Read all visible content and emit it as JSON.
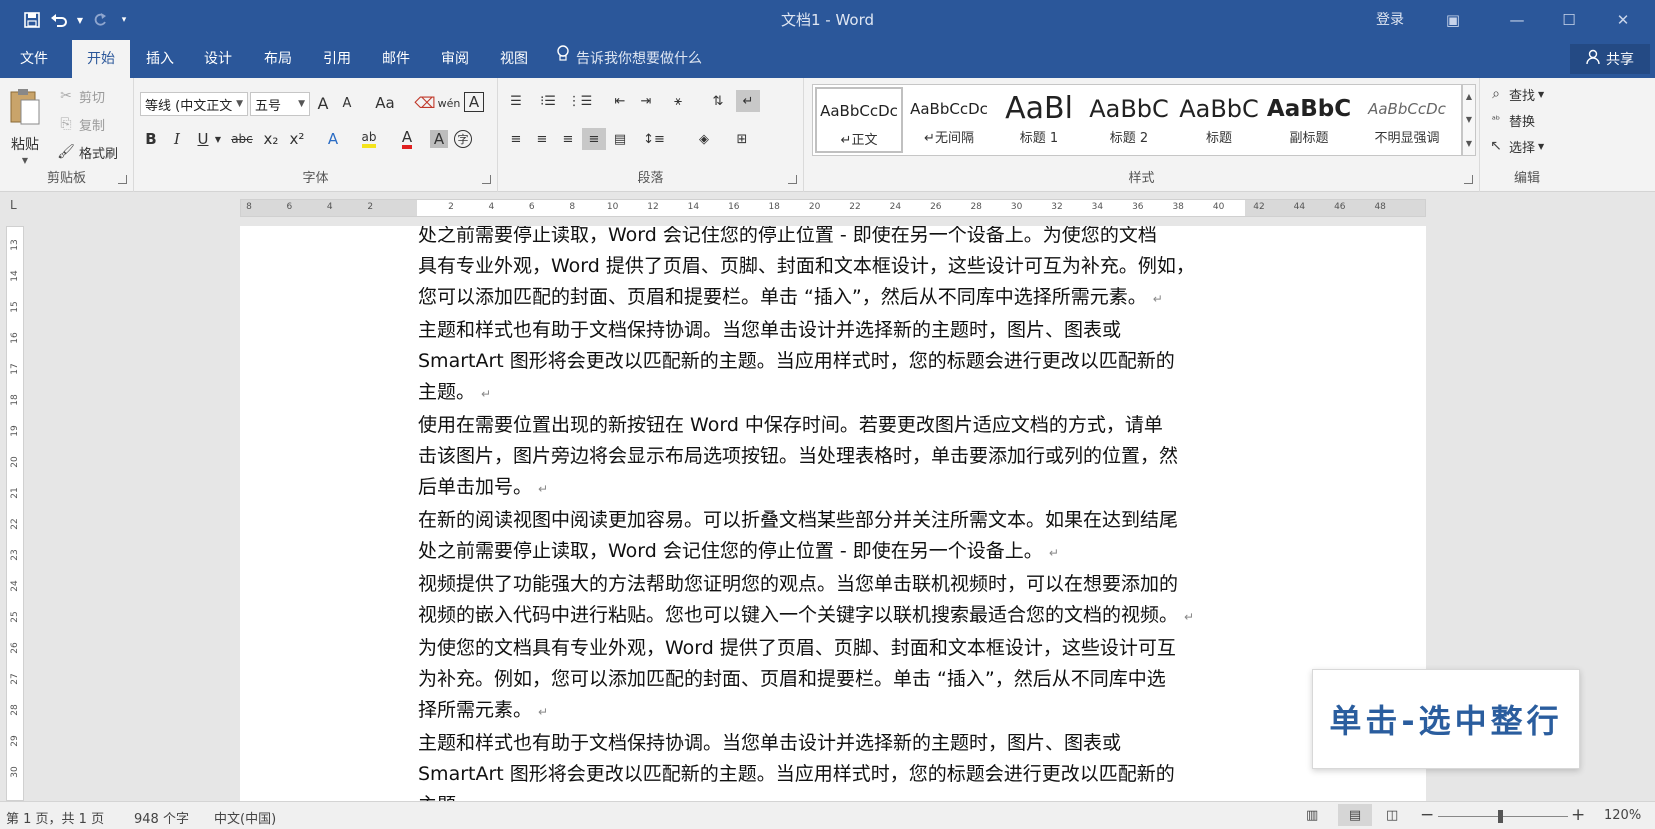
{
  "titlebar": {
    "title": "文档1 - Word",
    "login": "登录",
    "quick_access": {
      "save": "save",
      "undo": "undo",
      "redo": "redo",
      "customize": "customize"
    },
    "window_controls": {
      "ribbon_options": "▣",
      "minimize": "—",
      "maximize": "☐",
      "close": "✕"
    }
  },
  "tabs": [
    "文件",
    "开始",
    "插入",
    "设计",
    "布局",
    "引用",
    "邮件",
    "审阅",
    "视图"
  ],
  "active_tab": "开始",
  "tell_me": "告诉我你想要做什么",
  "share": "共享",
  "clipboard": {
    "label": "剪贴板",
    "paste": "粘贴",
    "cut": "剪切",
    "copy": "复制",
    "format_painter": "格式刷"
  },
  "font": {
    "label": "字体",
    "font_name": "等线 (中文正文",
    "font_size": "五号",
    "grow": "A",
    "shrink": "A",
    "case": "Aa",
    "bold": "B",
    "italic": "I",
    "underline": "U",
    "strike": "abc",
    "subscript": "x₂",
    "superscript": "x²",
    "pinyin": "wén",
    "char_border": "A",
    "text_effect": "A",
    "highlight": "ab",
    "font_color": "A",
    "char_shading": "A",
    "enclose": "字",
    "colors": {
      "highlight": "#f4e31c",
      "font_color": "#e02020"
    }
  },
  "paragraph": {
    "label": "段落"
  },
  "styles": {
    "label": "样式",
    "items": [
      {
        "sample": "AaBbCcDc",
        "name": "↵正文"
      },
      {
        "sample": "AaBbCcDc",
        "name": "↵无间隔"
      },
      {
        "sample": "AaBl",
        "name": "标题 1"
      },
      {
        "sample": "AaBbC",
        "name": "标题 2"
      },
      {
        "sample": "AaBbC",
        "name": "标题"
      },
      {
        "sample": "AaBbC",
        "name": "副标题"
      },
      {
        "sample": "AaBbCcDc",
        "name": "不明显强调"
      }
    ]
  },
  "editing": {
    "label": "编辑",
    "find": "查找",
    "replace": "替换",
    "select": "选择"
  },
  "ruler": {
    "h_ticks": [
      "8",
      "6",
      "4",
      "2",
      "",
      "2",
      "4",
      "6",
      "8",
      "10",
      "12",
      "14",
      "16",
      "18",
      "20",
      "22",
      "24",
      "26",
      "28",
      "30",
      "32",
      "34",
      "36",
      "38",
      "40",
      "42",
      "44",
      "46",
      "48"
    ],
    "v_ticks": [
      "13",
      "14",
      "15",
      "16",
      "17",
      "18",
      "19",
      "20",
      "21",
      "22",
      "23",
      "24",
      "25",
      "26",
      "27",
      "28",
      "29",
      "30"
    ],
    "corner": "L"
  },
  "document": {
    "paragraphs": [
      {
        "lines": [
          "处之前需要停止读取，Word 会记住您的停止位置 - 即使在另一个设备上。为使您的文档"
        ]
      },
      {
        "lines": [
          "具有专业外观，Word 提供了页眉、页脚、封面和文本框设计，这些设计可互为补充。例如，",
          "您可以添加匹配的封面、页眉和提要栏。单击 “插入”，然后从不同库中选择所需元素。"
        ],
        "mark": "↵"
      },
      {
        "lines": [
          "主题和样式也有助于文档保持协调。当您单击设计并选择新的主题时，图片、图表或",
          "SmartArt 图形将会更改以匹配新的主题。当应用样式时，您的标题会进行更改以匹配新的",
          "主题。"
        ],
        "mark": "↵"
      },
      {
        "lines": [
          "使用在需要位置出现的新按钮在 Word 中保存时间。若要更改图片适应文档的方式，请单",
          "击该图片，图片旁边将会显示布局选项按钮。当处理表格时，单击要添加行或列的位置，然",
          "后单击加号。"
        ],
        "mark": "↵"
      },
      {
        "lines": [
          "在新的阅读视图中阅读更加容易。可以折叠文档某些部分并关注所需文本。如果在达到结尾",
          "处之前需要停止读取，Word 会记住您的停止位置 - 即使在另一个设备上。"
        ],
        "mark": "↵"
      },
      {
        "lines": [
          "视频提供了功能强大的方法帮助您证明您的观点。当您单击联机视频时，可以在想要添加的",
          "视频的嵌入代码中进行粘贴。您也可以键入一个关键字以联机搜索最适合您的文档的视频。"
        ],
        "mark": "↵"
      },
      {
        "lines": [
          "为使您的文档具有专业外观，Word 提供了页眉、页脚、封面和文本框设计，这些设计可互",
          "为补充。例如，您可以添加匹配的封面、页眉和提要栏。单击 “插入”，然后从不同库中选",
          "择所需元素。"
        ],
        "mark": "↵"
      },
      {
        "lines": [
          "主题和样式也有助于文档保持协调。当您单击设计并选择新的主题时，图片、图表或",
          "SmartArt 图形将会更改以匹配新的主题。当应用样式时，您的标题会进行更改以匹配新的",
          "主题。"
        ],
        "mark": "↵"
      }
    ]
  },
  "caption": "单击-选中整行",
  "statusbar": {
    "page": "第 1 页，共 1 页",
    "words": "948 个字",
    "language": "中文(中国)",
    "zoom_minus": "−",
    "zoom_plus": "+",
    "zoom": "120%",
    "zoom_level_percent": 120
  },
  "colors": {
    "accent": "#2b579a",
    "caption_text": "#2a5d9e"
  }
}
